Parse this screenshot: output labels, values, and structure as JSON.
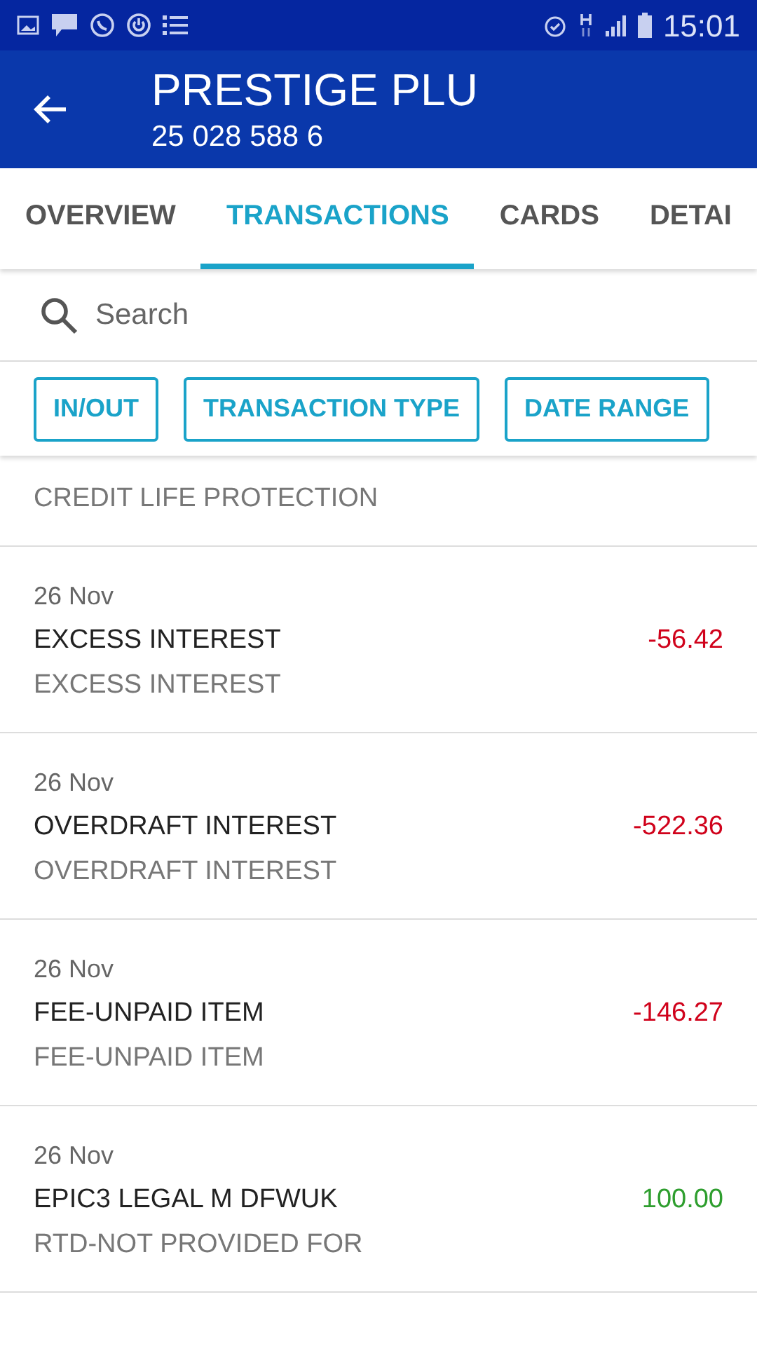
{
  "status_bar": {
    "time": "15:01"
  },
  "header": {
    "title": "PRESTIGE PLU",
    "subtitle": "25 028 588 6"
  },
  "tabs": [
    {
      "label": "OVERVIEW",
      "selected": false
    },
    {
      "label": "TRANSACTIONS",
      "selected": true
    },
    {
      "label": "CARDS",
      "selected": false
    },
    {
      "label": "DETAI",
      "selected": false
    }
  ],
  "search": {
    "placeholder": "Search"
  },
  "filters": [
    "IN/OUT",
    "TRANSACTION TYPE",
    "DATE RANGE"
  ],
  "transactions": [
    {
      "detail": "CREDIT LIFE PROTECTION"
    },
    {
      "date": "26 Nov",
      "description": "EXCESS INTEREST",
      "amount": "-56.42",
      "kind": "debit",
      "detail": "EXCESS INTEREST"
    },
    {
      "date": "26 Nov",
      "description": "OVERDRAFT INTEREST",
      "amount": "-522.36",
      "kind": "debit",
      "detail": "OVERDRAFT INTEREST"
    },
    {
      "date": "26 Nov",
      "description": "FEE-UNPAID ITEM",
      "amount": "-146.27",
      "kind": "debit",
      "detail": "FEE-UNPAID ITEM"
    },
    {
      "date": "26 Nov",
      "description": "EPIC3 LEGAL M DFWUK",
      "amount": "100.00",
      "kind": "credit",
      "detail": "RTD-NOT PROVIDED FOR"
    }
  ]
}
